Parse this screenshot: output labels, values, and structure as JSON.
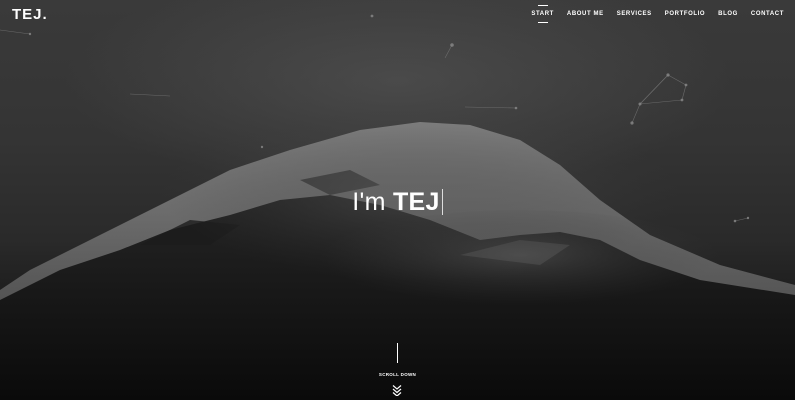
{
  "brand": {
    "logo_text": "TEJ."
  },
  "nav": {
    "items": [
      {
        "label": "START",
        "active": true
      },
      {
        "label": "ABOUT ME",
        "active": false
      },
      {
        "label": "SERVICES",
        "active": false
      },
      {
        "label": "PORTFOLIO",
        "active": false
      },
      {
        "label": "BLOG",
        "active": false
      },
      {
        "label": "CONTACT",
        "active": false
      }
    ]
  },
  "hero": {
    "prefix": "I'm ",
    "name": "TEJ",
    "background": "foggy snow-capped mountain, dark monochrome",
    "scroll_label": "SCROLL DOWN",
    "scroll_icon": "double-chevron-down-icon"
  },
  "colors": {
    "text": "#ffffff",
    "background_dark": "#141414",
    "background_mid": "#3a3a3a"
  }
}
